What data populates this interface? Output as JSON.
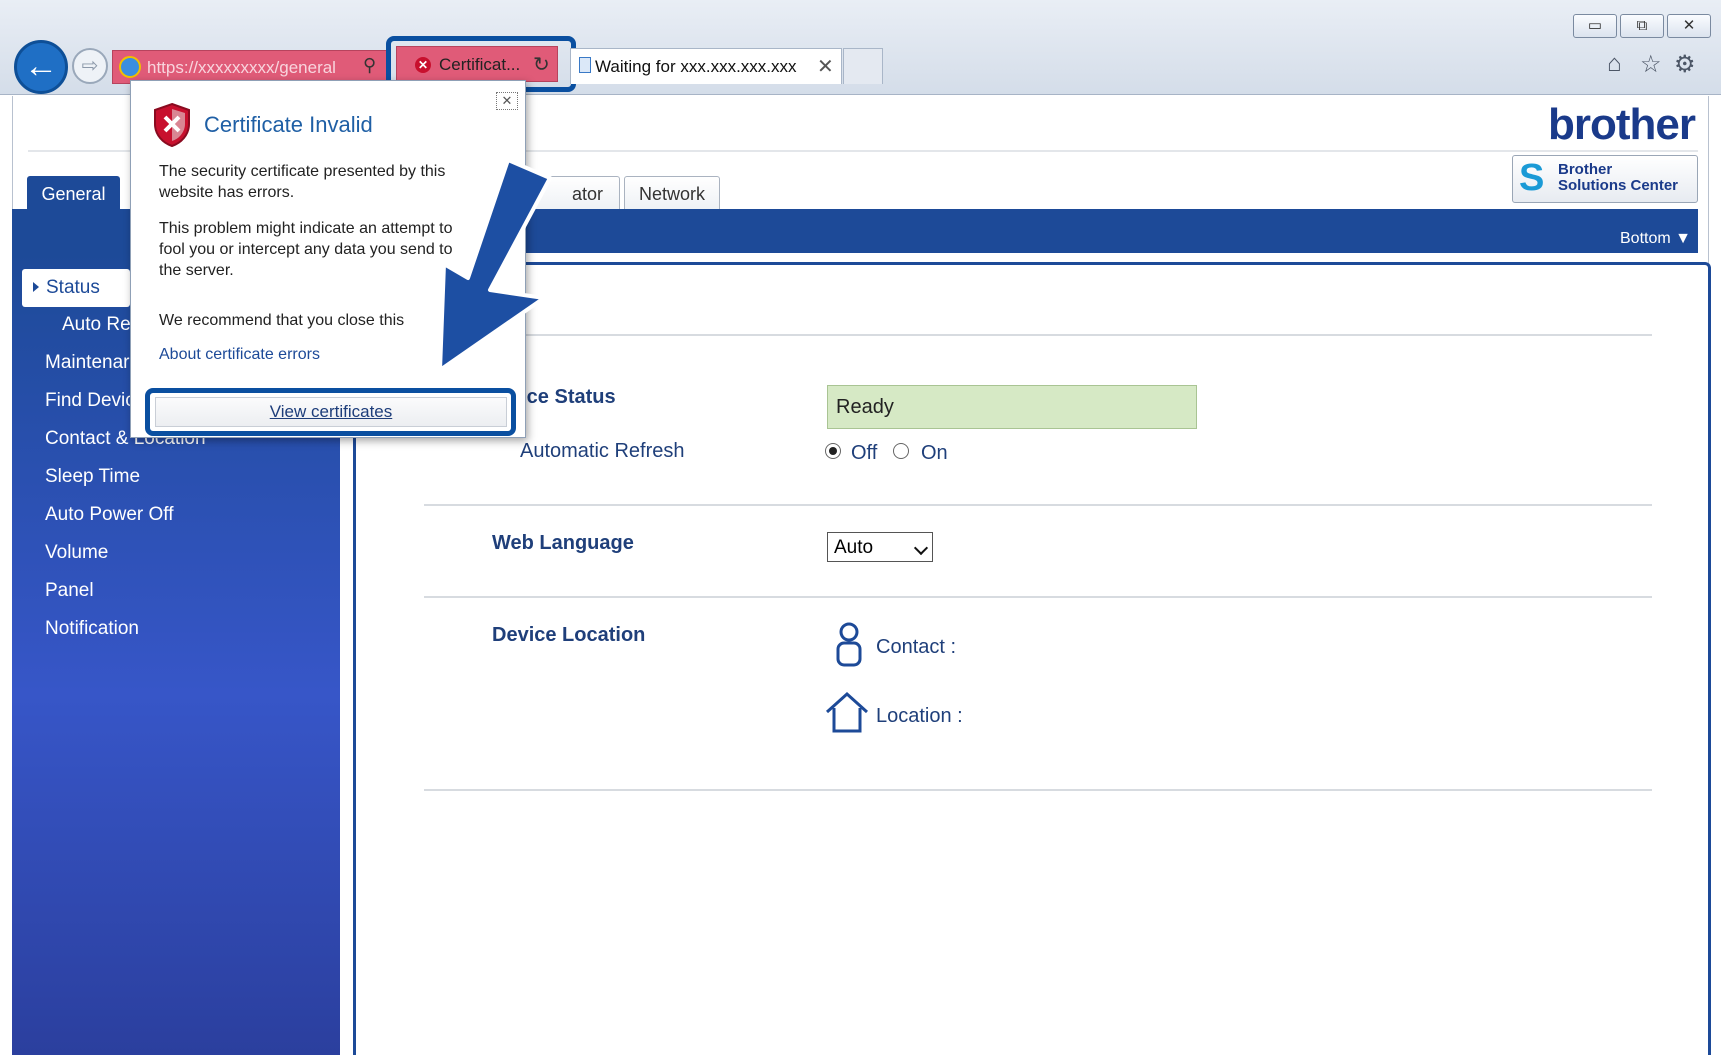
{
  "window": {
    "min": "▭",
    "restore": "⧉",
    "close": "✕"
  },
  "browser": {
    "url": "https://xxxxxxxxx/general",
    "cert_tab_label": "Certificat...",
    "tab2_label": "Waiting for xxx.xxx.xxx.xxx",
    "tab2_close": "✕",
    "tools": {
      "home": "⌂",
      "favorites": "☆",
      "settings": "⚙"
    },
    "back_glyph": "←",
    "forward_glyph": "⇨",
    "find_glyph": "⚲",
    "refresh_glyph": "↻"
  },
  "header": {
    "logo": "brother",
    "solutions_line1": "Brother",
    "solutions_line2": "Solutions Center",
    "bottom_link": "Bottom ▼"
  },
  "tabs": {
    "general": "General",
    "administrator_partial": "ator",
    "network": "Network"
  },
  "sidebar": {
    "items": [
      {
        "label": "Status",
        "selected": true
      },
      {
        "label": "Auto Re"
      },
      {
        "label": "Maintenar"
      },
      {
        "label": "Find Devic"
      },
      {
        "label": "Contact & Location"
      },
      {
        "label": "Sleep Time"
      },
      {
        "label": "Auto Power Off"
      },
      {
        "label": "Volume"
      },
      {
        "label": "Panel"
      },
      {
        "label": "Notification"
      }
    ]
  },
  "main": {
    "device_status_label": "vice Status",
    "device_status_value": "Ready",
    "auto_refresh_label": "Automatic Refresh",
    "refresh_off": "Off",
    "refresh_on": "On",
    "web_language_label": "Web Language",
    "web_language_value": "Auto",
    "device_location_label": "Device Location",
    "contact_label": "Contact :",
    "location_label": "Location :"
  },
  "popup": {
    "title": "Certificate Invalid",
    "para1_line1": "The security certificate presented by this",
    "para1_line2": "website has errors.",
    "para2_line1": "This problem might indicate an attempt to",
    "para2_line2": "fool you or intercept any data you send to",
    "para2_line3": "the server.",
    "para3": "We recommend that you close this",
    "about_link": "About certificate errors",
    "view_button": "View certificates",
    "close_glyph": "✕"
  },
  "colors": {
    "brand_blue": "#1d4a98",
    "error_pink": "#e05b78",
    "highlight_blue": "#0a4fa0",
    "ready_green": "#d6e9c5"
  },
  "icons": [
    "back-arrow-icon",
    "forward-arrow-icon",
    "ie-globe-icon",
    "search-icon",
    "error-x-icon",
    "refresh-icon",
    "page-icon",
    "home-icon",
    "star-icon",
    "gear-icon",
    "shield-error-icon",
    "person-icon",
    "house-icon",
    "down-arrow-annotation"
  ]
}
